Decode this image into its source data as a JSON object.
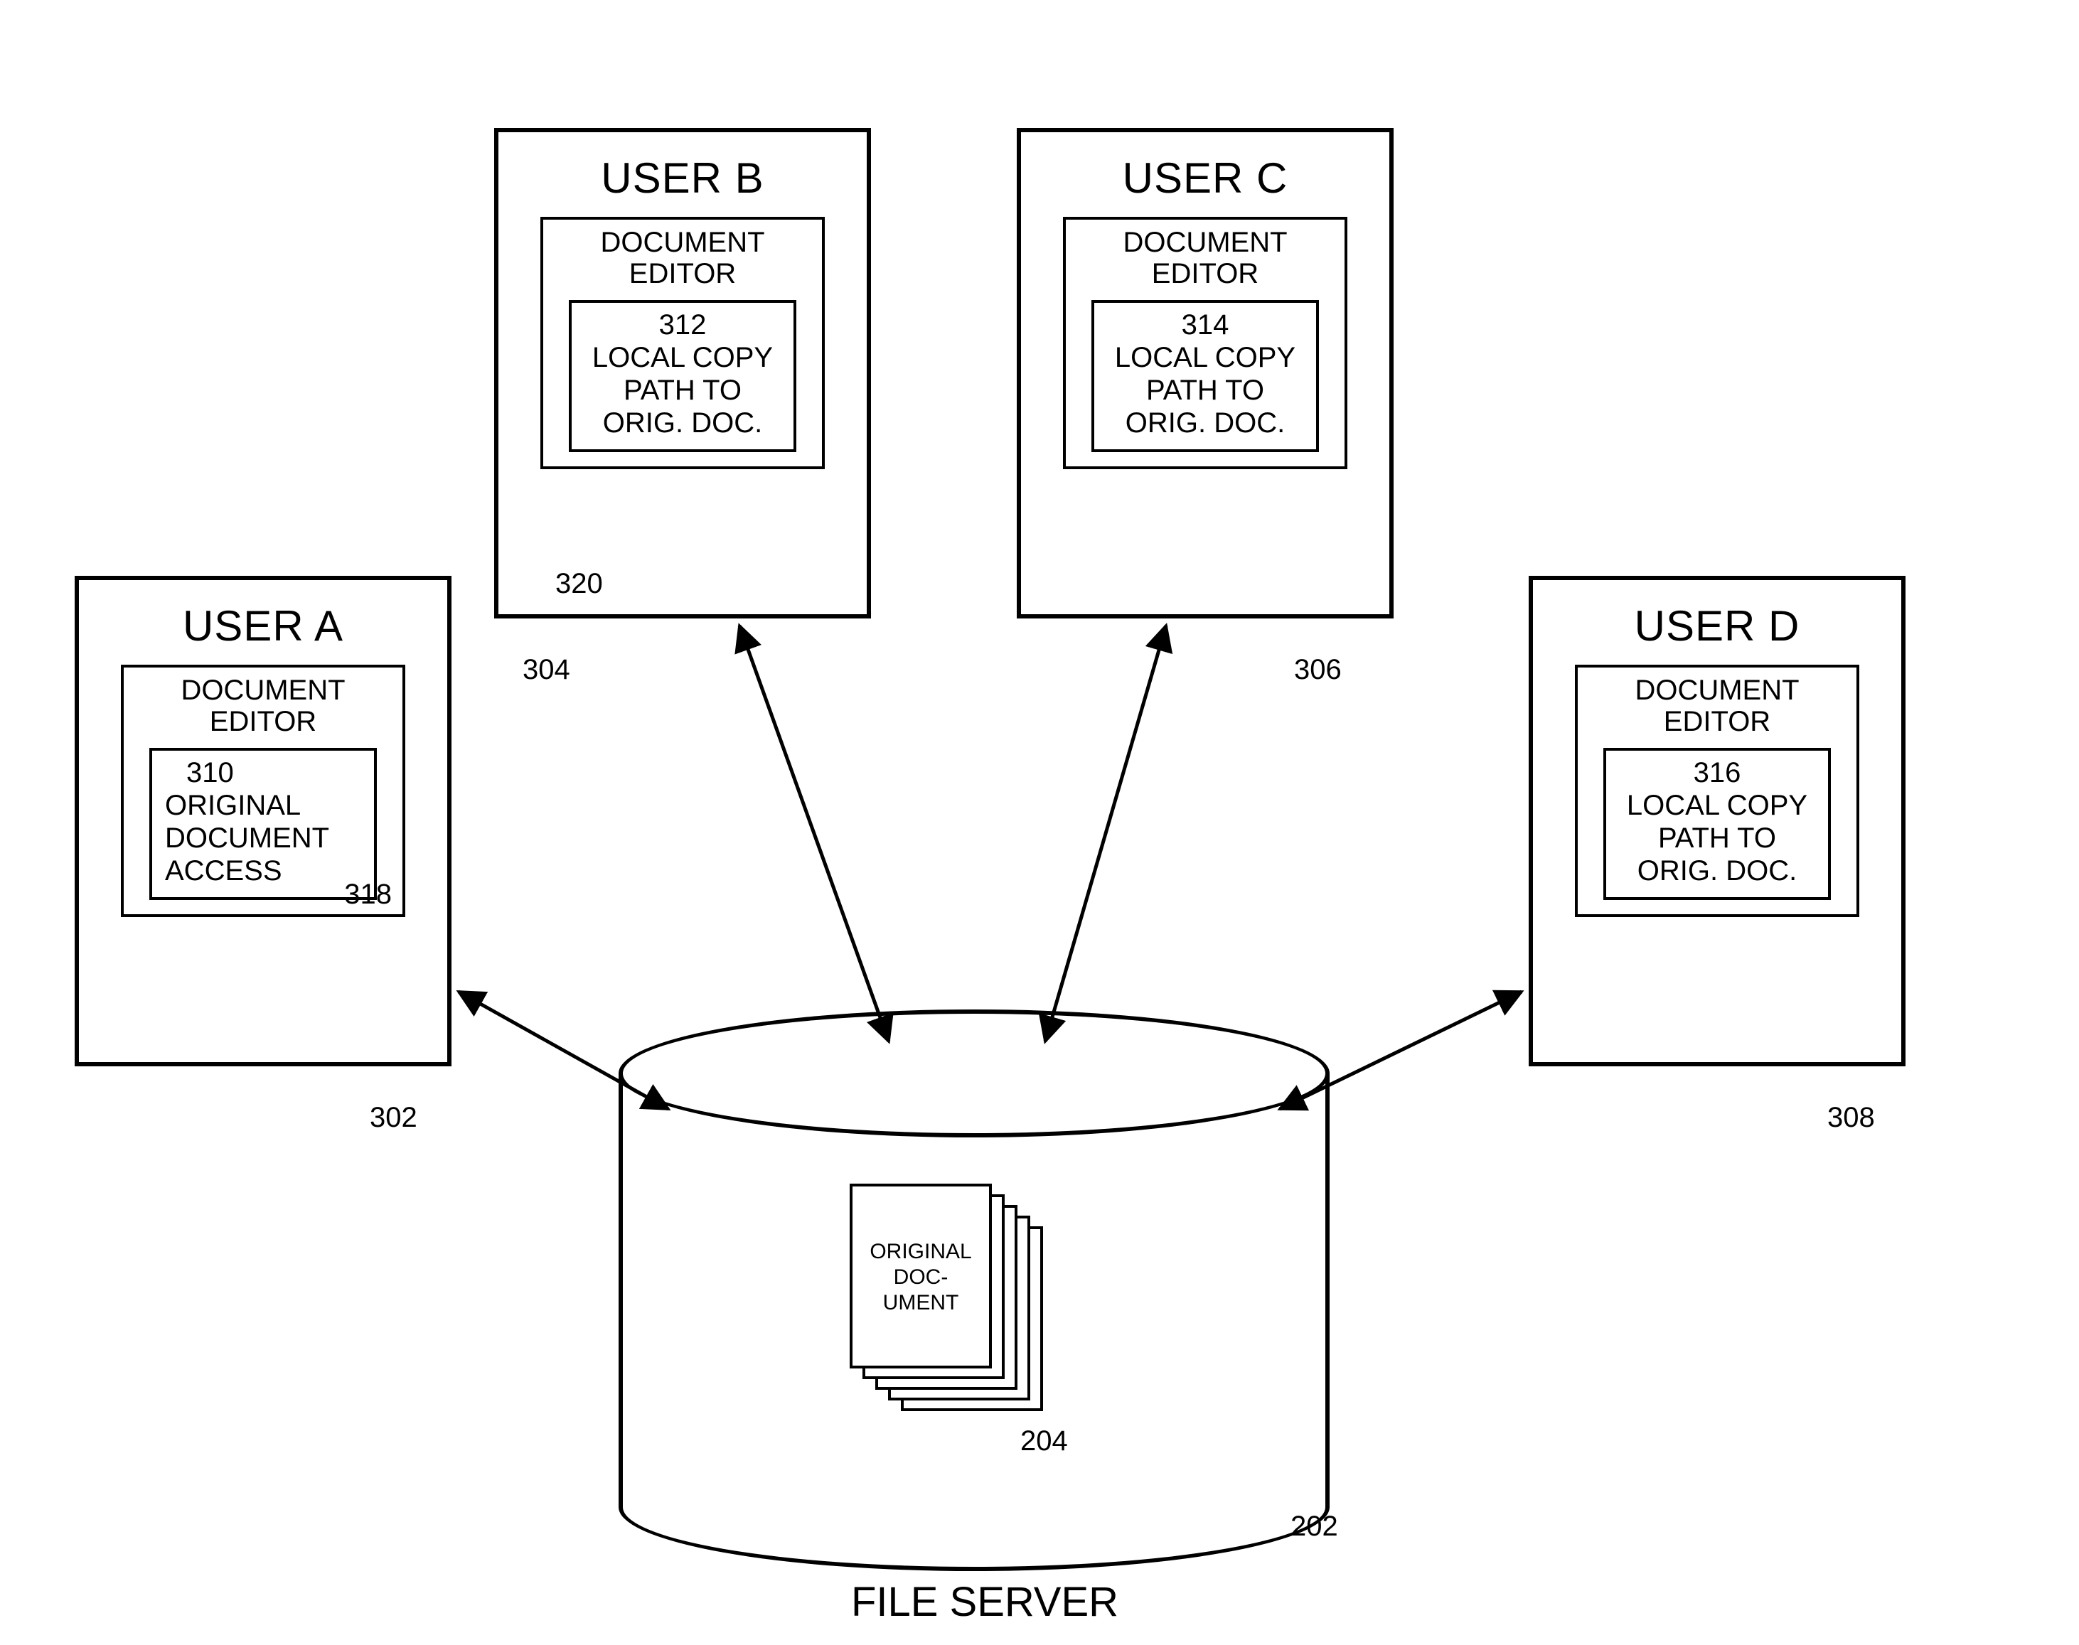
{
  "users": {
    "a": {
      "title": "USER A",
      "editor": "DOCUMENT\nEDITOR",
      "inner_ref": "310",
      "inner_text": "ORIGINAL\nDOCUMENT\nACCESS",
      "editor_ref": "318",
      "box_ref": "302"
    },
    "b": {
      "title": "USER B",
      "editor": "DOCUMENT\nEDITOR",
      "inner_ref": "312",
      "inner_text": "LOCAL COPY\nPATH TO\nORIG. DOC.",
      "editor_ref": "320",
      "box_ref": "304"
    },
    "c": {
      "title": "USER C",
      "editor": "DOCUMENT\nEDITOR",
      "inner_ref": "314",
      "inner_text": "LOCAL COPY\nPATH TO\nORIG. DOC.",
      "editor_ref": "",
      "box_ref": "306"
    },
    "d": {
      "title": "USER D",
      "editor": "DOCUMENT\nEDITOR",
      "inner_ref": "316",
      "inner_text": "LOCAL COPY\nPATH TO\nORIG. DOC.",
      "editor_ref": "",
      "box_ref": "308"
    }
  },
  "server": {
    "label": "FILE SERVER",
    "doc_label": "ORIGINAL\nDOC-\nUMENT",
    "doc_ref": "204",
    "ref": "202"
  }
}
